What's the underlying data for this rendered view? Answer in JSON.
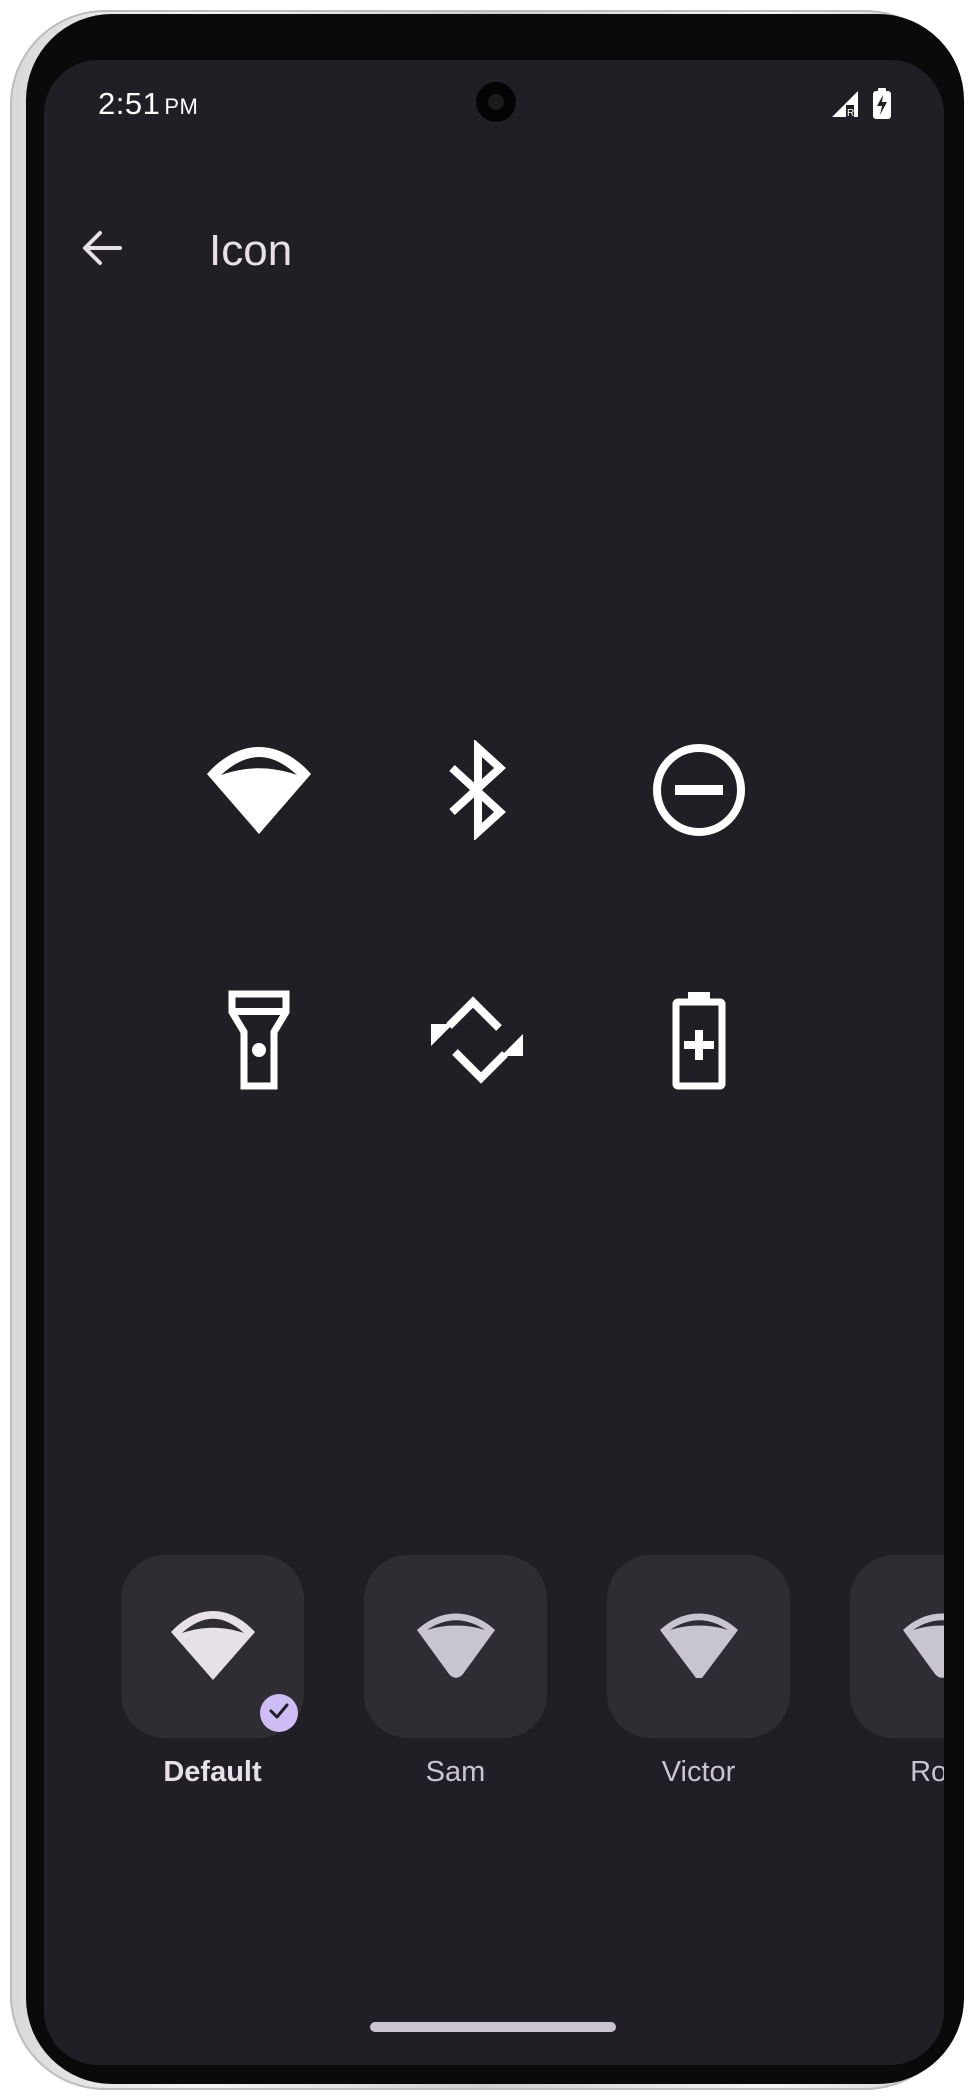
{
  "status_bar": {
    "time": "2:51",
    "ampm": "PM",
    "icons": [
      "signal-icon",
      "battery-charging-icon"
    ]
  },
  "header": {
    "back_icon": "arrow-back-icon",
    "title": "Icon"
  },
  "preview": {
    "icons": [
      "wifi-icon",
      "bluetooth-icon",
      "do-not-disturb-icon",
      "flashlight-icon",
      "auto-rotate-icon",
      "battery-saver-icon"
    ]
  },
  "options": [
    {
      "label": "Default",
      "icon": "wifi-icon",
      "selected": true
    },
    {
      "label": "Sam",
      "icon": "wifi-icon",
      "selected": false
    },
    {
      "label": "Victor",
      "icon": "wifi-icon",
      "selected": false
    },
    {
      "label": "Rour",
      "icon": "wifi-icon",
      "selected": false
    }
  ],
  "colors": {
    "background": "#211f26",
    "tile": "#2f2d34",
    "accent": "#cdbdf4",
    "text": "#e6e1e8"
  }
}
